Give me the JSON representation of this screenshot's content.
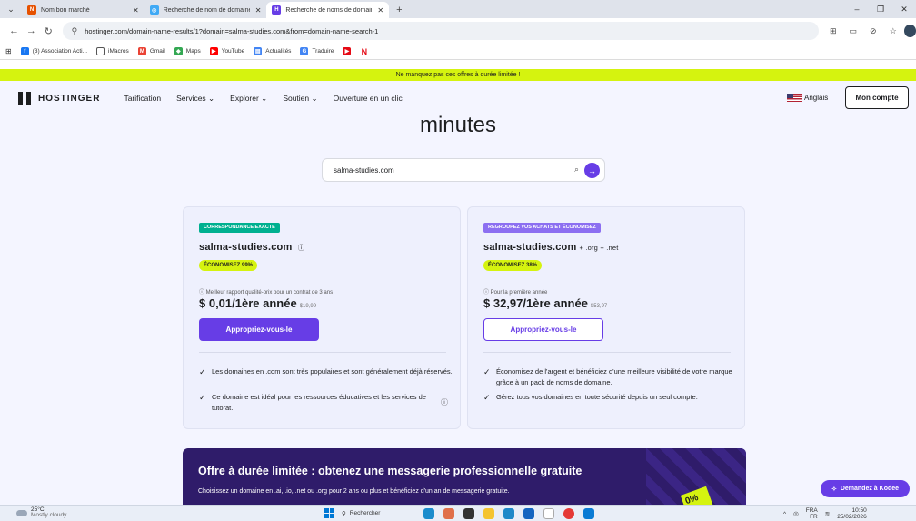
{
  "browser": {
    "tabs": [
      {
        "title": "Nom bon marché",
        "color": "#e65100",
        "active": false
      },
      {
        "title": "Recherche de nom de domaine",
        "color": "#3fa9f5",
        "active": false
      },
      {
        "title": "Recherche de noms de domain",
        "color": "#673de6",
        "active": true
      }
    ],
    "new_tab": "+",
    "url": "hostinger.com/domain-name-results/1?domain=salma-studies.com&from=domain-name-search-1",
    "bookmarks": [
      {
        "label": "(3) Association Acti...",
        "color": "#1877f2"
      },
      {
        "label": "iMacros",
        "color": "#555555"
      },
      {
        "label": "Gmail",
        "color": "#ea4335"
      },
      {
        "label": "Maps",
        "color": "#34a853"
      },
      {
        "label": "YouTube",
        "color": "#ff0000"
      },
      {
        "label": "Actualités",
        "color": "#4285f4"
      },
      {
        "label": "Traduire",
        "color": "#4285f4"
      },
      {
        "label": "",
        "color": "#e50914"
      },
      {
        "label": "",
        "color": "#e50914"
      }
    ]
  },
  "promo_banner": "Ne manquez pas ces offres à durée limitée !",
  "header": {
    "brand": "HOSTINGER",
    "nav": [
      "Tarification",
      "Services ⌄",
      "Explorer ⌄",
      "Soutien ⌄",
      "Ouverture en un clic"
    ],
    "language": "Anglais",
    "account_button": "Mon compte"
  },
  "heading": "minutes",
  "search": {
    "value": "salma-studies.com"
  },
  "cards": [
    {
      "badge": "CORRESPONDANCE EXACTE",
      "domain": "salma-studies.com",
      "domain_extra": "",
      "save": "ÉCONOMISEZ 99%",
      "price_note": "ⓘ Meilleur rapport qualité-prix pour un contrat de 3 ans",
      "price": "$ 0,01/1ère année",
      "old_price": "$19,99",
      "cta": "Appropriez-vous-le",
      "features": [
        "Les domaines en .com sont très populaires et sont généralement déjà réservés.",
        "Ce domaine est idéal pour les ressources éducatives et les services de tutorat."
      ]
    },
    {
      "badge": "REGROUPEZ VOS ACHATS ET ÉCONOMISEZ",
      "domain": "salma-studies.com",
      "domain_extra": "+ .org + .net",
      "save": "ÉCONOMISEZ 38%",
      "price_note": "ⓘ Pour la première année",
      "price": "$ 32,97/1ère année",
      "old_price": "$53,97",
      "cta": "Appropriez-vous-le",
      "features": [
        "Économisez de l'argent et bénéficiez d'une meilleure visibilité de votre marque grâce à un pack de noms de domaine.",
        "Gérez tous vos domaines en toute sécurité depuis un seul compte."
      ]
    }
  ],
  "offer": {
    "title": "Offre à durée limitée : obtenez une messagerie professionnelle gratuite",
    "text": "Choisissez un domaine en .ai, .io, .net ou .org pour 2 ans ou plus et bénéficiez d'un an de messagerie gratuite.",
    "deco": "0%"
  },
  "help_button": "Demandez à Kodee",
  "taskbar": {
    "temp": "25°C",
    "weather": "Mostly cloudy",
    "search": "Rechercher",
    "lang": "FRA",
    "lang2": "FR",
    "time": "10:50",
    "date": "25/02/2026"
  }
}
